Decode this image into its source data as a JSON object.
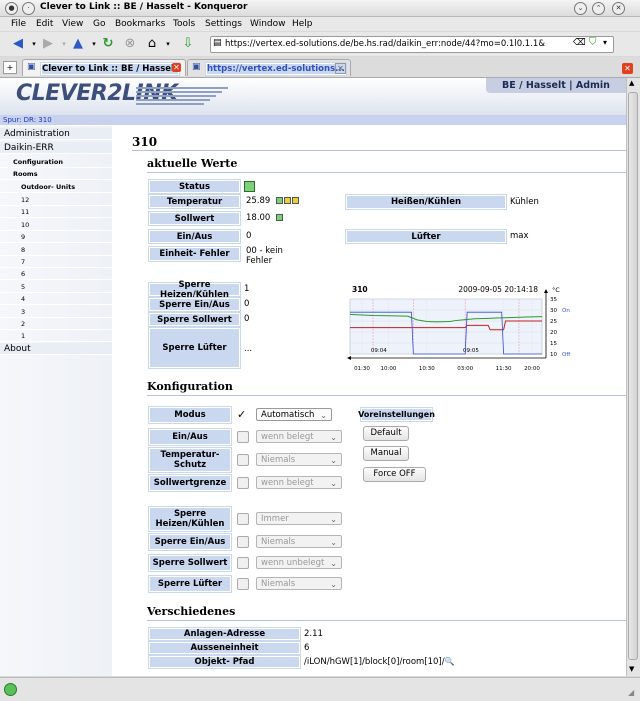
{
  "window": {
    "title": "Clever to Link :: BE / Hasselt - Konqueror"
  },
  "menu": [
    "File",
    "Edit",
    "View",
    "Go",
    "Bookmarks",
    "Tools",
    "Settings",
    "Window",
    "Help"
  ],
  "toolbar": {
    "url": "https://vertex.ed-solutions.de/be.hs.rad/daikin_err:node/44?mo=0.1l0.1.1&lng=de"
  },
  "tabs": [
    {
      "label": "Clever to Link :: BE / Hasselt"
    },
    {
      "label": "https://vertex.ed-solutions..."
    }
  ],
  "header": {
    "logo": "CLEVER2LINK",
    "user": "BE / Hasselt | Admin"
  },
  "spur": "Spur: DR: 310",
  "sidebar": {
    "administration": "Administration",
    "daikin": "Daikin-ERR",
    "configuration": "Configuration",
    "rooms": "Rooms",
    "outdoor": "Outdoor- Units",
    "numbers": [
      "12",
      "11",
      "10",
      "9",
      "8",
      "7",
      "6",
      "5",
      "4",
      "3",
      "2",
      "1"
    ],
    "about": "About"
  },
  "main": {
    "title": "310",
    "section1": "aktuelle Werte",
    "status_label": "Status",
    "temp_label": "Temperatur",
    "temp_value": "25.89",
    "soll_label": "Sollwert",
    "soll_value": "18.00",
    "einaus_label": "Ein/Aus",
    "einaus_value": "0",
    "fehler_label": "Einheit- Fehler",
    "fehler_value": "00 - kein Fehler",
    "heiss_label": "Heißen/Kühlen",
    "heiss_value": "Kühlen",
    "luefter_label": "Lüfter",
    "luefter_value": "max",
    "sp_heiz_label": "Sperre Heizen/Kühlen",
    "sp_heiz_value": "1",
    "sp_einaus_label": "Sperre Ein/Aus",
    "sp_einaus_value": "0",
    "sp_soll_label": "Sperre Sollwert",
    "sp_soll_value": "0",
    "sp_luefter_label": "Sperre Lüfter",
    "sp_luefter_value": "..."
  },
  "chart_data": {
    "type": "line",
    "title": "310",
    "timestamp": "2009-09-05 20:14:18",
    "x_ticks": [
      "01:30",
      "10:00",
      "10:30",
      "03:00",
      "11:30",
      "20:00"
    ],
    "date_labels": [
      "09:04",
      "09:05"
    ],
    "y_ticks": [
      "35",
      "30",
      "25",
      "20",
      "15",
      "10"
    ],
    "unit": "°C",
    "on_label": "On",
    "off_label": "Off",
    "ylim": [
      10,
      35
    ],
    "series": [
      {
        "color": "#2a9a2a",
        "x": [
          0,
          0.05,
          0.12,
          0.2,
          0.26,
          0.3,
          0.35,
          0.4,
          0.45,
          0.52,
          0.55,
          0.6,
          0.65,
          0.72,
          0.78,
          0.85,
          0.92,
          1.0
        ],
        "values": [
          28,
          27.8,
          27.5,
          27.4,
          27.3,
          27.2,
          25.5,
          24.8,
          24.6,
          24.8,
          25.2,
          25.6,
          26,
          26.2,
          26.4,
          26.6,
          26.8,
          27
        ]
      },
      {
        "color": "#c02020",
        "x": [
          0,
          0.32,
          0.33,
          0.6,
          0.61,
          0.72,
          0.73,
          0.8,
          0.81,
          1.0
        ],
        "values": [
          22,
          22,
          22,
          22,
          23,
          23,
          21,
          21,
          25,
          25
        ]
      },
      {
        "color": "#3050d0",
        "x": [
          0,
          0.32,
          0.33,
          0.6,
          0.61,
          0.79,
          0.8,
          1.0
        ],
        "values": [
          29,
          29,
          10,
          10,
          29,
          29,
          10,
          10
        ]
      }
    ]
  },
  "config": {
    "title": "Konfiguration",
    "modus_label": "Modus",
    "modus_value": "Automatisch",
    "einaus_label": "Ein/Aus",
    "einaus_value": "wenn belegt",
    "tempschutz_label": "Temperatur- Schutz",
    "tempschutz_value": "Niemals",
    "sollgrenze_label": "Sollwertgrenze",
    "sollgrenze_value": "wenn belegt",
    "sp_heiz_label": "Sperre Heizen/Kühlen",
    "sp_heiz_value": "Immer",
    "sp_einaus_label": "Sperre Ein/Aus",
    "sp_einaus_value": "Niemals",
    "sp_soll_label": "Sperre Sollwert",
    "sp_soll_value": "wenn unbelegt",
    "sp_luefter_label": "Sperre Lüfter",
    "sp_luefter_value": "Niemals",
    "voreinst_label": "Voreinstellungen",
    "btn_default": "Default",
    "btn_manual": "Manual",
    "btn_force": "Force OFF"
  },
  "misc": {
    "title": "Verschiedenes",
    "anlage_label": "Anlagen-Adresse",
    "anlage_value": "2.11",
    "aussen_label": "Ausseneinheit",
    "aussen_value": "6",
    "pfad_label": "Objekt- Pfad",
    "pfad_value": "/iLON/hGW[1]/block[0]/room[10]/"
  },
  "colors": {
    "label_bg": "#c9d7ef",
    "accent": "#3d4f7a",
    "status_green": "#7ad17a"
  }
}
